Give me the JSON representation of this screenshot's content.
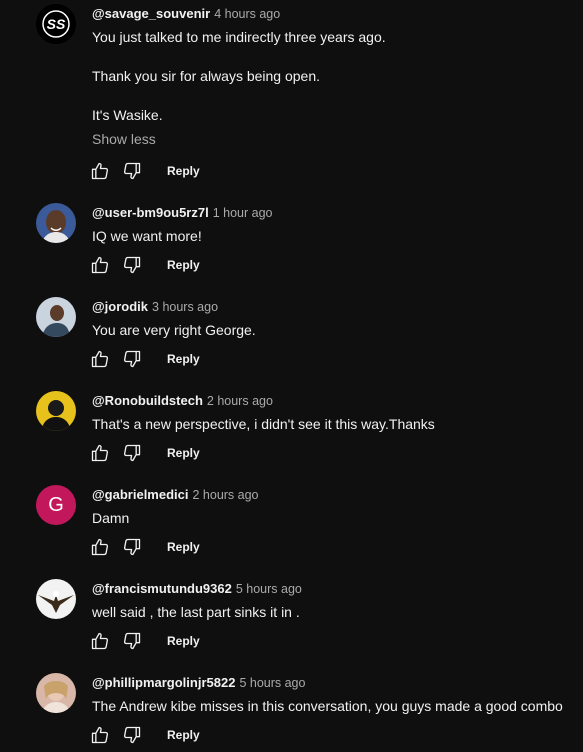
{
  "comments": [
    {
      "author": "@savage_souvenir",
      "time": "4 hours ago",
      "paragraphs": [
        "You just talked to me indirectly three years ago.",
        "Thank you sir for always being open.",
        "It's Wasike."
      ],
      "show_less": "Show less",
      "reply": "Reply",
      "avatar": {
        "kind": "logo",
        "text": "SS",
        "bg": "#000000"
      }
    },
    {
      "author": "@user-bm9ou5rz7l",
      "time": "1 hour ago",
      "paragraphs": [
        "IQ we want more!"
      ],
      "reply": "Reply",
      "avatar": {
        "kind": "photo",
        "bg": "#3a5a9a"
      }
    },
    {
      "author": "@jorodik",
      "time": "3 hours ago",
      "paragraphs": [
        "You are very right George."
      ],
      "reply": "Reply",
      "avatar": {
        "kind": "photo",
        "bg": "#c9d4df"
      }
    },
    {
      "author": "@Ronobuildstech",
      "time": "2 hours ago",
      "paragraphs": [
        "That's a new perspective, i didn't see it this way.Thanks"
      ],
      "reply": "Reply",
      "avatar": {
        "kind": "photo",
        "bg": "#e8c21c"
      }
    },
    {
      "author": "@gabrielmedici",
      "time": "2 hours ago",
      "paragraphs": [
        "Damn"
      ],
      "reply": "Reply",
      "avatar": {
        "kind": "letter",
        "text": "G",
        "bg": "#c2185b"
      }
    },
    {
      "author": "@francismutundu9362",
      "time": "5 hours ago",
      "paragraphs": [
        "well said , the last part sinks it in ."
      ],
      "reply": "Reply",
      "avatar": {
        "kind": "photo",
        "bg": "#f2f2f2"
      }
    },
    {
      "author": "@phillipmargolinjr5822",
      "time": "5 hours ago",
      "paragraphs": [
        "The Andrew kibe misses in this conversation, you guys made a good combo"
      ],
      "reply": "Reply",
      "avatar": {
        "kind": "photo",
        "bg": "#d8b7a8"
      }
    }
  ],
  "icons": {
    "like": "thumbs-up-icon",
    "dislike": "thumbs-down-icon"
  }
}
